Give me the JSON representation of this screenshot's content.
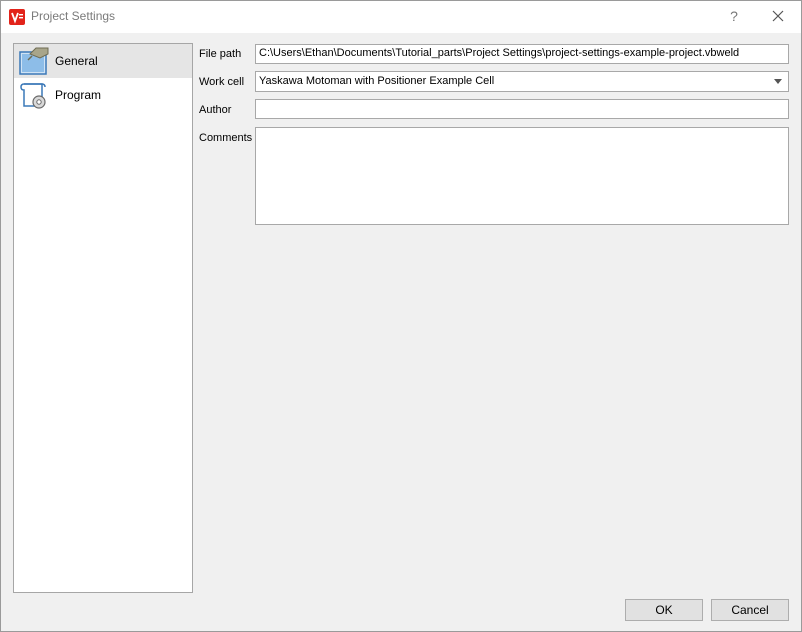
{
  "window": {
    "title": "Project Settings",
    "help_label": "?",
    "close_label": "✕"
  },
  "sidebar": {
    "items": [
      {
        "label": "General",
        "icon": "general-settings-icon",
        "selected": true
      },
      {
        "label": "Program",
        "icon": "program-scroll-gear-icon",
        "selected": false
      }
    ]
  },
  "form": {
    "file_path": {
      "label": "File path",
      "value": "C:\\Users\\Ethan\\Documents\\Tutorial_parts\\Project Settings\\project-settings-example-project.vbweld"
    },
    "work_cell": {
      "label": "Work cell",
      "value": "Yaskawa Motoman with Positioner Example Cell"
    },
    "author": {
      "label": "Author",
      "value": ""
    },
    "comments": {
      "label": "Comments",
      "value": ""
    }
  },
  "buttons": {
    "ok": "OK",
    "cancel": "Cancel"
  },
  "colors": {
    "app_icon_red": "#e2231a",
    "selected_item_bg": "#e5e5e5",
    "icon_blue": "#5b9bd5"
  }
}
